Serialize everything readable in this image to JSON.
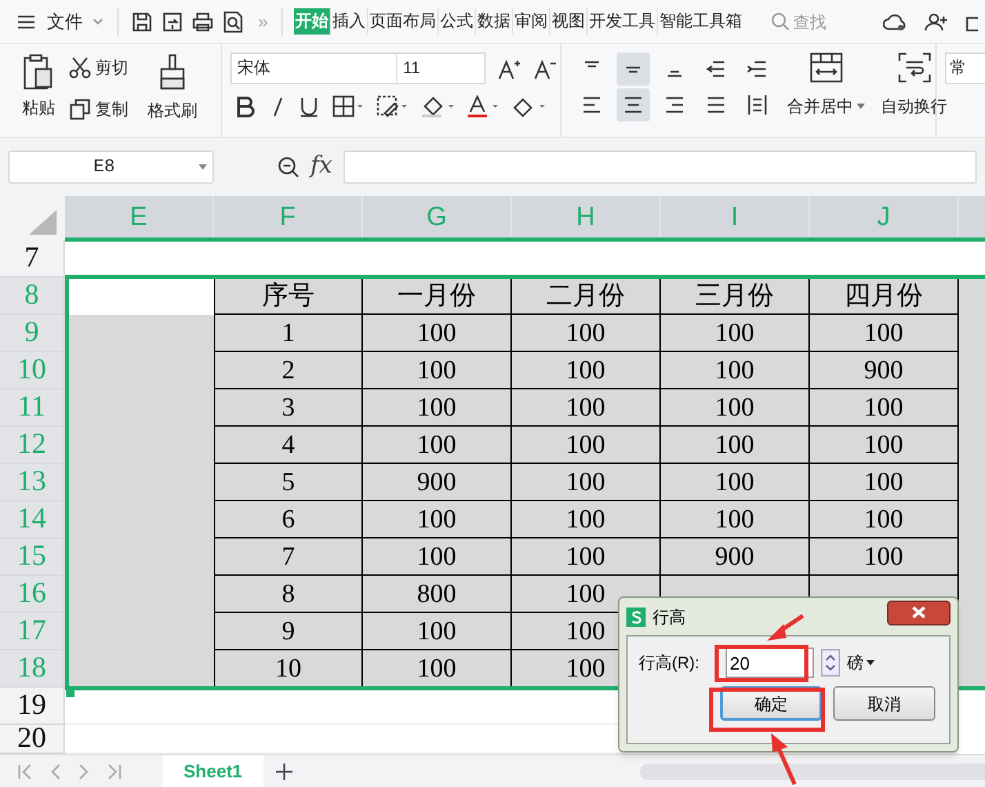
{
  "menu_bar": {
    "file_menu": "文件",
    "more": "»",
    "tabs": [
      {
        "label": "开始",
        "selected": true
      },
      {
        "label": "插入",
        "selected": false
      },
      {
        "label": "页面布局",
        "selected": false
      },
      {
        "label": "公式",
        "selected": false
      },
      {
        "label": "数据",
        "selected": false
      },
      {
        "label": "审阅",
        "selected": false
      },
      {
        "label": "视图",
        "selected": false
      },
      {
        "label": "开发工具",
        "selected": false
      },
      {
        "label": "智能工具箱",
        "selected": false
      }
    ],
    "search": "查找"
  },
  "ribbon": {
    "paste": "粘贴",
    "cut": "剪切",
    "copy": "复制",
    "format_painter": "格式刷",
    "font_name": "宋体",
    "font_size": "11",
    "merge_center": "合并居中",
    "wrap_text": "自动换行",
    "number_format": "常",
    "align_top_row": [
      {
        "selected": false
      },
      {
        "selected": true
      },
      {
        "selected": false
      },
      {
        "selected": false
      },
      {
        "selected": false
      }
    ],
    "align_bottom_row": [
      {
        "selected": false
      },
      {
        "selected": true
      },
      {
        "selected": false
      },
      {
        "selected": false
      },
      {
        "selected": false
      }
    ]
  },
  "formula_bar": {
    "name_box": "E8",
    "fx": "fx"
  },
  "sheet": {
    "columns": [
      {
        "label": "E",
        "selected": true
      },
      {
        "label": "F",
        "selected": true
      },
      {
        "label": "G",
        "selected": true
      },
      {
        "label": "H",
        "selected": true
      },
      {
        "label": "I",
        "selected": true
      },
      {
        "label": "J",
        "selected": true
      }
    ],
    "rows": [
      {
        "number": "7",
        "selected": false
      },
      {
        "number": "8",
        "selected": true,
        "cells": [
          "序号",
          "一月份",
          "二月份",
          "三月份",
          "四月份"
        ]
      },
      {
        "number": "9",
        "selected": true,
        "cells": [
          "1",
          "100",
          "100",
          "100",
          "100"
        ]
      },
      {
        "number": "10",
        "selected": true,
        "cells": [
          "2",
          "100",
          "100",
          "100",
          "900"
        ]
      },
      {
        "number": "11",
        "selected": true,
        "cells": [
          "3",
          "100",
          "100",
          "100",
          "100"
        ]
      },
      {
        "number": "12",
        "selected": true,
        "cells": [
          "4",
          "100",
          "100",
          "100",
          "100"
        ]
      },
      {
        "number": "13",
        "selected": true,
        "cells": [
          "5",
          "900",
          "100",
          "100",
          "100"
        ]
      },
      {
        "number": "14",
        "selected": true,
        "cells": [
          "6",
          "100",
          "100",
          "100",
          "100"
        ]
      },
      {
        "number": "15",
        "selected": true,
        "cells": [
          "7",
          "100",
          "100",
          "900",
          "100"
        ]
      },
      {
        "number": "16",
        "selected": true,
        "cells": [
          "8",
          "800",
          "100",
          null,
          null
        ]
      },
      {
        "number": "17",
        "selected": true,
        "cells": [
          "9",
          "100",
          "100",
          null,
          null
        ]
      },
      {
        "number": "18",
        "selected": true,
        "cells": [
          "10",
          "100",
          "100",
          null,
          null
        ]
      },
      {
        "number": "19",
        "selected": false
      },
      {
        "number": "20",
        "selected": false
      }
    ]
  },
  "sheet_tabs": [
    {
      "label": "Sheet1",
      "selected": true
    }
  ],
  "dialog": {
    "title": "行高",
    "label": "行高(R):",
    "value": "20",
    "unit": "磅",
    "buttons": [
      {
        "label": "确定",
        "selected": true
      },
      {
        "label": "取消",
        "selected": false
      }
    ]
  }
}
